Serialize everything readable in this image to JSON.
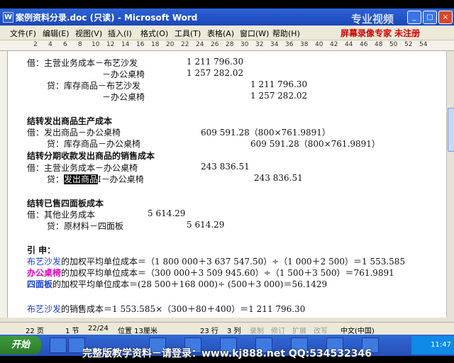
{
  "window": {
    "title": "案例资料分录.doc (只读) - Microsoft Word",
    "watermark": "专业视频",
    "brand": "屏幕录像专家 未注册"
  },
  "menu": [
    "文件(F)",
    "编辑(E)",
    "视图(V)",
    "插入(I)",
    "格式(O)",
    "工具(T)",
    "表格(A)",
    "窗口(W)",
    "帮助(H)"
  ],
  "ruler": [
    "2",
    "4",
    "6",
    "8",
    "10",
    "12",
    "14",
    "16",
    "18",
    "20",
    "22",
    "24",
    "26",
    "28",
    "30",
    "32",
    "34",
    "36",
    "38",
    "40",
    "42",
    "44",
    "46",
    "48",
    "50",
    "52",
    "54"
  ],
  "doc": {
    "l1a": "借：主营业务成本－布艺沙发",
    "l1b": "1 211 796.30",
    "l2a": "－办公桌椅",
    "l2b": "1 257 282.02",
    "l3a": "贷：库存商品－布艺沙发",
    "l3b": "1 211 796.30",
    "l4a": "－办公桌椅",
    "l4b": "1 257 282.02",
    "h1": "结转发出商品生产成本",
    "l5a": "借：发出商品－办公桌椅",
    "l5b": "609 591.28（800×761.9891）",
    "l6a": "贷：库存商品－办公桌椅",
    "l6b": "609 591.28（800×761.9891）",
    "h2": "结转分期收款发出商品的销售成本",
    "l7a": "借：主营业务成本－办公桌椅",
    "l7b": "243 836.51",
    "l8pre": "贷：",
    "l8sel": "发出商品",
    "l8post": "－办公桌椅",
    "l8b": "243 836.51",
    "h3": "结转已售四面板成本",
    "l9a": "借：其他业务成本",
    "l9b": "5 614.29",
    "l10a": "贷：原材料－四面板",
    "l10b": "5 614.29",
    "h4": "引  申：",
    "f1k": "布艺沙发",
    "f1": "的加权平均单位成本＝（1 800 000＋3 637 547.50）÷（1 000＋2 500）＝1 553.585",
    "f2k": "办公桌椅",
    "f2": "的加权平均单位成本＝（300 000＋3 509 945.60）÷（1 500＋3 500）＝761.9891",
    "f3k": "四面板",
    "f3": "的加权平均单位成本＝(28 500＋168 000)÷ (500＋3 000)＝56.1429",
    "f4k": "布艺沙发",
    "f4": "的销售成本＝1 553.585×（300＋80＋400）＝1 211 796.30"
  },
  "status": {
    "page": "22 页",
    "section": "1 节",
    "pages": "22/24",
    "pos": "位置 13厘米",
    "row": "23 行",
    "col": "3 列",
    "rec": "录制",
    "trk": "修订",
    "ext": "扩展",
    "ovr": "改写",
    "lang": "中文(中国)"
  },
  "taskbar": {
    "start": "开始",
    "time": "11:47"
  },
  "bottom_watermark": "完整版教学资料－请登录：www.kj888.net  QQ:534532346"
}
